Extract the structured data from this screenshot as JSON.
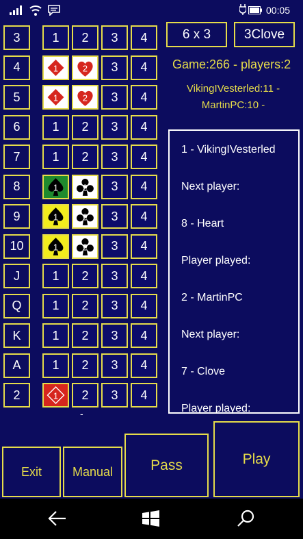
{
  "status": {
    "time": "00:05"
  },
  "ranks": [
    "3",
    "4",
    "5",
    "6",
    "7",
    "8",
    "9",
    "10",
    "J",
    "Q",
    "K",
    "A",
    "2"
  ],
  "columns": [
    [
      "1",
      "2",
      "3",
      "4"
    ],
    [
      "card-diamond-1",
      "card-heart-2",
      "3",
      "4"
    ],
    [
      "card-diamond-1",
      "card-heart-2",
      "3",
      "4"
    ],
    [
      "1",
      "2",
      "3",
      "4"
    ],
    [
      "1",
      "2",
      "3",
      "4"
    ],
    [
      "card-spade-1-green",
      "card-clove-2",
      "3",
      "4"
    ],
    [
      "card-spade-1-yellow",
      "card-clove-2",
      "3",
      "4"
    ],
    [
      "card-spade-1-yellow",
      "card-clove-2",
      "3",
      "4"
    ],
    [
      "1",
      "2",
      "3",
      "4"
    ],
    [
      "1",
      "2",
      "3",
      "4"
    ],
    [
      "1",
      "2",
      "3",
      "4"
    ],
    [
      "1",
      "2",
      "3",
      "4"
    ],
    [
      "card-diamond-1-red",
      "2",
      "3",
      "4"
    ]
  ],
  "header": {
    "grid_button": "6 x 3",
    "card_button": "3Clove",
    "game_info": "Game:266 - players:2",
    "scores_line1": "VikingIVesterled:11 -",
    "scores_line2": "MartinPC:10 -"
  },
  "log_lines": [
    "1 - VikingIVesterled",
    "Next player:",
    "8 - Heart",
    "Player played:",
    "2 - MartinPC",
    "Next player:",
    "7 - Clove",
    "Player played:"
  ],
  "separator": "-",
  "buttons": {
    "exit": "Exit",
    "manual": "Manual",
    "pass": "Pass",
    "play": "Play"
  },
  "colors": {
    "background": "#0c0c5e",
    "accent": "#e6dc4a",
    "card_red": "#d6261e",
    "card_green": "#1f8a2e",
    "card_yellow": "#f2ec1e"
  },
  "icons": [
    "back-arrow-icon",
    "windows-logo-icon",
    "search-icon"
  ]
}
